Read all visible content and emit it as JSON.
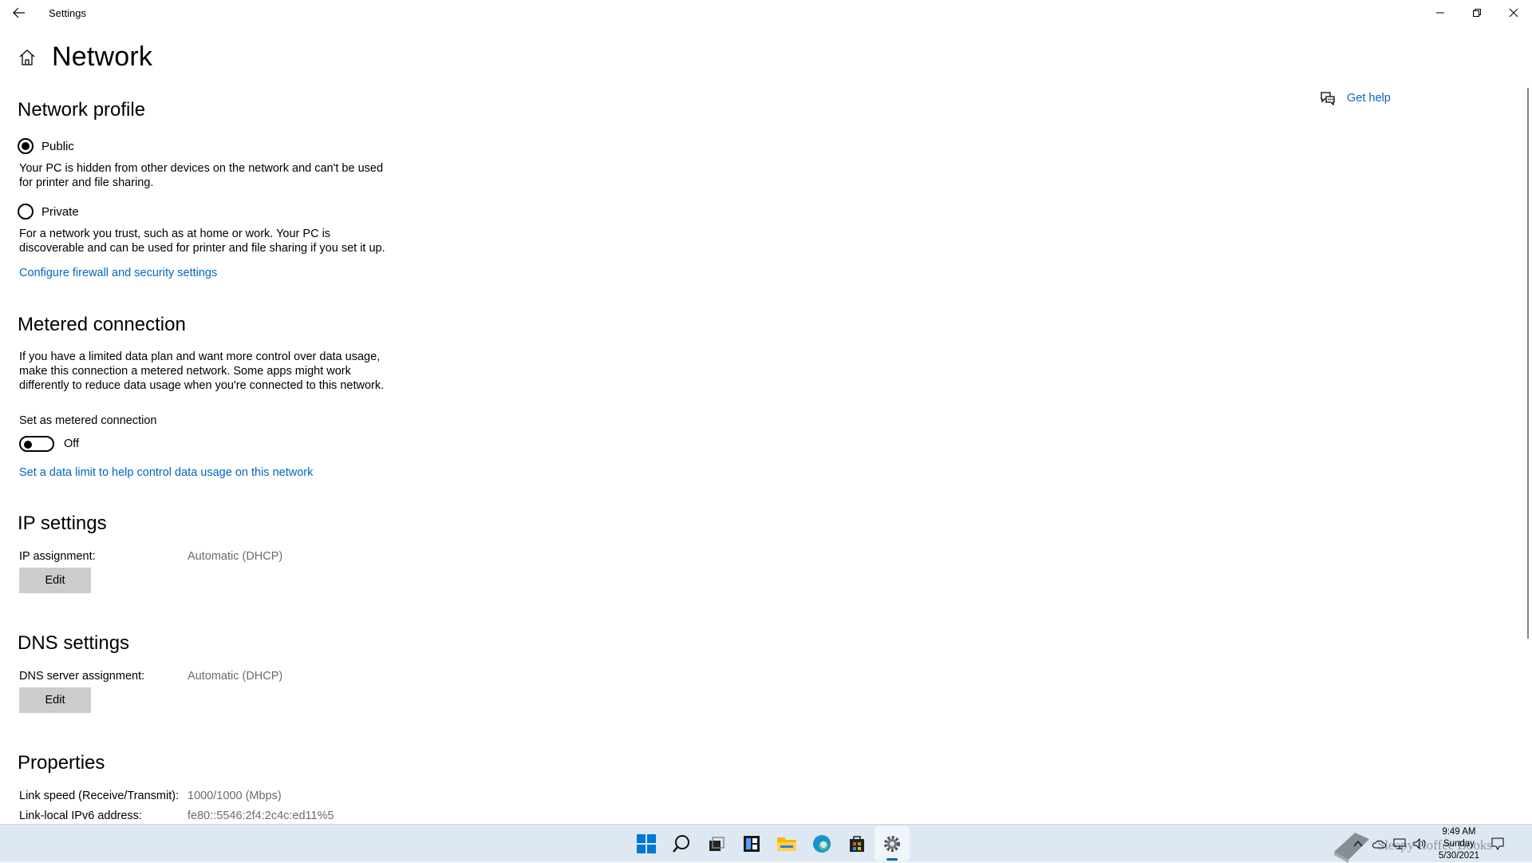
{
  "window": {
    "title": "Settings",
    "controls": {
      "minimize": "minimize-icon",
      "restore": "restore-icon",
      "close": "close-icon"
    }
  },
  "page": {
    "title": "Network"
  },
  "help": {
    "label": "Get help"
  },
  "network_profile": {
    "title": "Network profile",
    "options": [
      {
        "label": "Public",
        "selected": true,
        "description": "Your PC is hidden from other devices on the network and can't be used for printer and file sharing."
      },
      {
        "label": "Private",
        "selected": false,
        "description": "For a network you trust, such as at home or work. Your PC is discoverable and can be used for printer and file sharing if you set it up."
      }
    ],
    "link": "Configure firewall and security settings"
  },
  "metered": {
    "title": "Metered connection",
    "description": "If you have a limited data plan and want more control over data usage, make this connection a metered network. Some apps might work differently to reduce data usage when you're connected to this network.",
    "toggle_label": "Set as metered connection",
    "toggle_state": "Off",
    "link": "Set a data limit to help control data usage on this network"
  },
  "ip_settings": {
    "title": "IP settings",
    "label": "IP assignment:",
    "value": "Automatic (DHCP)",
    "button": "Edit"
  },
  "dns_settings": {
    "title": "DNS settings",
    "label": "DNS server assignment:",
    "value": "Automatic (DHCP)",
    "button": "Edit"
  },
  "properties": {
    "title": "Properties",
    "rows": [
      {
        "label": "Link speed (Receive/Transmit):",
        "value": "1000/1000 (Mbps)"
      },
      {
        "label": "Link-local IPv6 address:",
        "value": "fe80::5546:2f4:2c4c:ed11%5"
      }
    ]
  },
  "taskbar": {
    "icons": [
      "start-icon",
      "search-icon",
      "task-view-icon",
      "widgets-icon",
      "file-explorer-icon",
      "edge-icon",
      "store-icon",
      "settings-icon"
    ],
    "active": "settings-icon",
    "clock": {
      "time": "9:49 AM",
      "day": "Sunday",
      "date": "5/30/2021"
    },
    "watermark": "Sleepy Coffee Books",
    "colors": {
      "accent": "#0067c0",
      "taskbar_bg": "#dde8f3"
    }
  }
}
